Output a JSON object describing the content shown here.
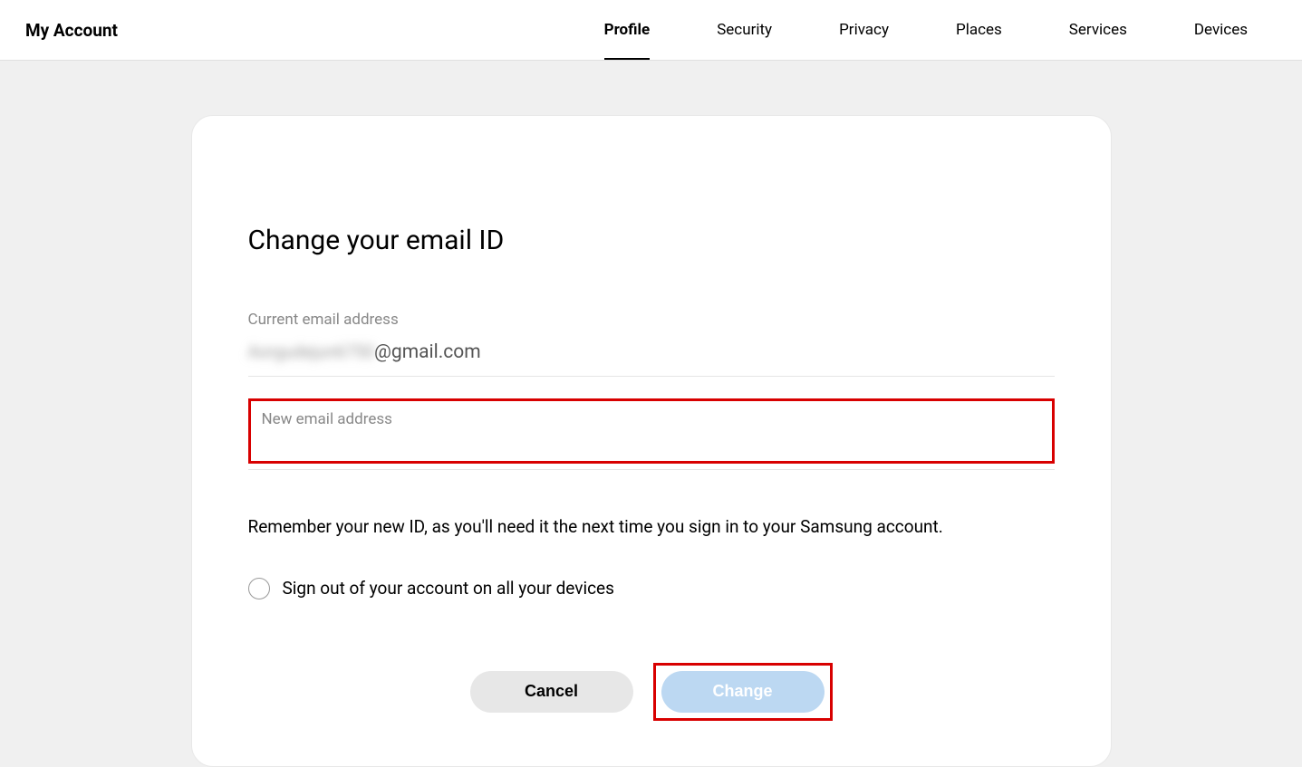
{
  "header": {
    "title": "My Account",
    "tabs": [
      {
        "label": "Profile",
        "active": true
      },
      {
        "label": "Security",
        "active": false
      },
      {
        "label": "Privacy",
        "active": false
      },
      {
        "label": "Places",
        "active": false
      },
      {
        "label": "Services",
        "active": false
      },
      {
        "label": "Devices",
        "active": false
      }
    ]
  },
  "card": {
    "title": "Change your email ID",
    "current_email_label": "Current email address",
    "current_email_blurred": "Aorgudejun6750",
    "current_email_domain": "@gmail.com",
    "new_email_label": "New email address",
    "new_email_value": "",
    "reminder": "Remember your new ID, as you'll need it the next time you sign in to your Samsung account.",
    "signout_label": "Sign out of your account on all your devices",
    "signout_checked": false,
    "cancel_label": "Cancel",
    "change_label": "Change"
  }
}
